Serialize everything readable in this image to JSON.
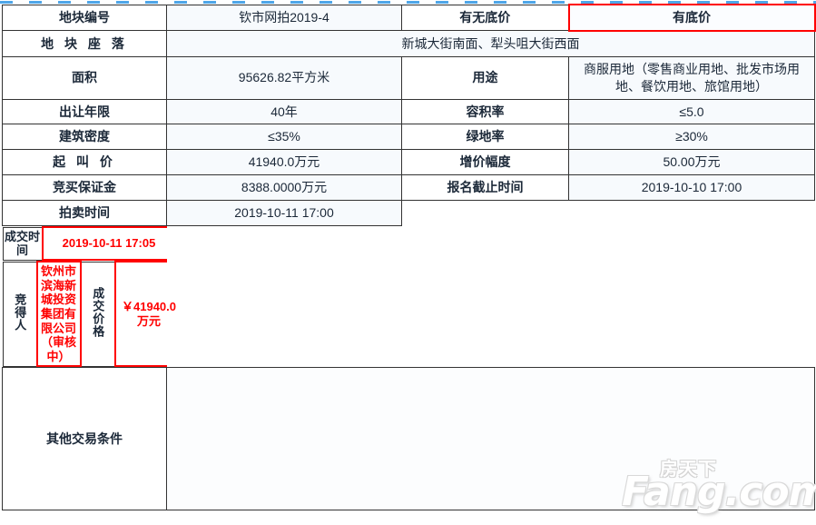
{
  "rows": {
    "parcel_no_label": "地块编号",
    "parcel_no_value": "钦市网拍2019-4",
    "has_floor_price_label": "有无底价",
    "has_floor_price_value": "有底价",
    "location_label": "地 块 座 落",
    "location_value": "新城大街南面、犁头咀大街西面",
    "area_label": "面积",
    "area_value": "95626.82平方米",
    "usage_label": "用途",
    "usage_value": "商服用地（零售商业用地、批发市场用地、餐饮用地、旅馆用地）",
    "term_label": "出让年限",
    "term_value": "40年",
    "far_label": "容积率",
    "far_value": "≤5.0",
    "building_density_label": "建筑密度",
    "building_density_value": "≤35%",
    "green_ratio_label": "绿地率",
    "green_ratio_value": "≥30%",
    "start_price_label": "起 叫 价",
    "start_price_value": "41940.0万元",
    "increment_label": "增价幅度",
    "increment_value": "50.00万元",
    "deposit_label": "竞买保证金",
    "deposit_value": "8388.0000万元",
    "register_deadline_label": "报名截止时间",
    "register_deadline_value": "2019-10-10 17:00",
    "auction_time_label": "拍卖时间",
    "auction_time_value": "2019-10-11 17:00"
  },
  "result": {
    "deal_time_label": "成交时间",
    "deal_time_value": "2019-10-11 17:05",
    "winner_label": "竞得人",
    "winner_value": "钦州市滨海新城投资集团有限公司（审核中）",
    "deal_price_label": "成交价格",
    "deal_price_value": "￥41940.0万元"
  },
  "other": {
    "label": "其他交易条件",
    "value": ""
  },
  "watermark": {
    "brand_latin": "Fang.com",
    "brand_cn": "房天下"
  },
  "colors": {
    "accent_red": "#ff0000",
    "border": "#333333",
    "value_bg": "#f7fafd",
    "text": "#1b2838"
  }
}
